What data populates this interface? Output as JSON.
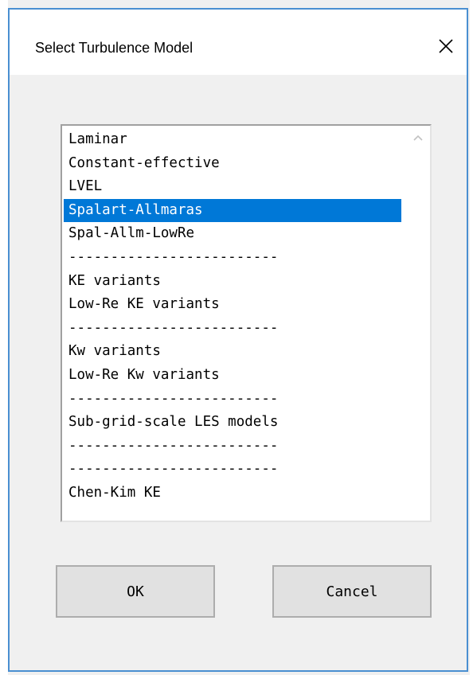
{
  "dialog": {
    "title": "Select Turbulence Model",
    "close_icon": "close-icon"
  },
  "list": {
    "items": [
      "Laminar",
      "Constant-effective",
      "LVEL",
      "Spalart-Allmaras",
      "Spal-Allm-LowRe",
      "-------------------------",
      "KE variants",
      "Low-Re KE variants",
      "-------------------------",
      "Kw variants",
      "Low-Re Kw variants",
      "-------------------------",
      "Sub-grid-scale LES models",
      "-------------------------",
      "-------------------------",
      "Chen-Kim KE"
    ],
    "selected_index": 3
  },
  "buttons": {
    "ok_label": "OK",
    "cancel_label": "Cancel"
  },
  "colors": {
    "selection": "#0078d7",
    "window_border": "#4a8fd1"
  }
}
